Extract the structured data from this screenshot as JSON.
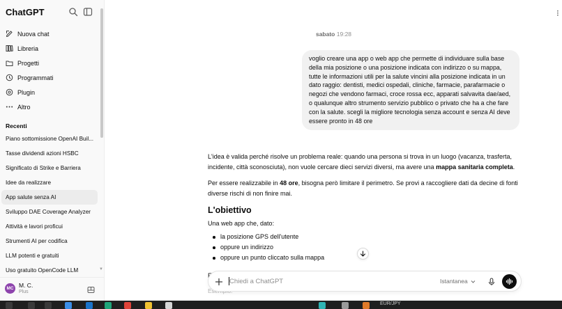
{
  "sidebar": {
    "brand": "ChatGPT",
    "nav": [
      {
        "label": "Nuova chat",
        "icon": "edit-icon"
      },
      {
        "label": "Libreria",
        "icon": "library-icon"
      },
      {
        "label": "Progetti",
        "icon": "folder-icon"
      },
      {
        "label": "Programmati",
        "icon": "clock-icon"
      },
      {
        "label": "Plugin",
        "icon": "plugin-icon"
      },
      {
        "label": "Altro",
        "icon": "more-icon"
      }
    ],
    "recent_label": "Recenti",
    "recent": [
      "Piano sottomissione OpenAI Buil...",
      "Tasse dividendi azioni HSBC",
      "Significato di Strike e Barriera",
      "Idee da realizzare",
      "App salute senza AI",
      "Sviluppo DAE Coverage Analyzer",
      "Attività e lavori proficui",
      "Strumenti AI per codifica",
      "LLM potenti e gratuiti",
      "Uso gratuito OpenCode LLM"
    ],
    "active_recent": 4,
    "user": {
      "initials": "MC",
      "name": "M. C.",
      "plan": "Plus"
    }
  },
  "main": {
    "timestamp_day": "sabato",
    "timestamp_time": "19:28",
    "user_message": "voglio creare una app o web app che permette di individuare sulla base della mia posizione o una posizione indicata con indirizzo o su mappa, tutte le informazioni utili per la salute vincini alla posizione indicata in un dato raggio: dentisti, medici ospedali, cliniche, farmacie, parafarmacie o negozi che vendono farmaci, croce rossa ecc, apparati salvavita dae/aed, o qualunque altro strumento servizio pubblico o privato che ha a che fare con la salute. scegli la migliore tecnologia senza account e senza AI  deve essere pronto in 48 ore",
    "assistant": {
      "p1_a": "L'idea è valida perché risolve un problema reale: quando una persona si trova in un luogo (vacanza, trasferta, incidente, città sconosciuta), non vuole cercare dieci servizi diversi, ma avere una ",
      "p1_b": "mappa sanitaria completa",
      "p1_c": ".",
      "p2_a": "Per essere realizzabile in ",
      "p2_b": "48 ore",
      "p2_c": ", bisogna però limitare il perimetro. Se provi a raccogliere dati da decine di fonti diverse rischi di non finire mai.",
      "heading": "L'obiettivo",
      "p3": "Una web app che, dato:",
      "bullets": [
        "la posizione GPS dell'utente",
        "oppure un indirizzo",
        "oppure un punto cliccato sulla mappa"
      ],
      "next_partial": "E",
      "faded_below": "Esempio:"
    },
    "composer": {
      "placeholder": "Chiedi a ChatGPT",
      "mode": "Istantanea"
    }
  },
  "taskbar": {
    "ticker": "EUR/JPY"
  },
  "colors": {
    "sidebar_bg": "#f9f9f9",
    "bubble_bg": "#f1f1f1",
    "active_item": "#ececec",
    "avatar": "#8e44ad",
    "taskbar": "#1f1f1f"
  }
}
